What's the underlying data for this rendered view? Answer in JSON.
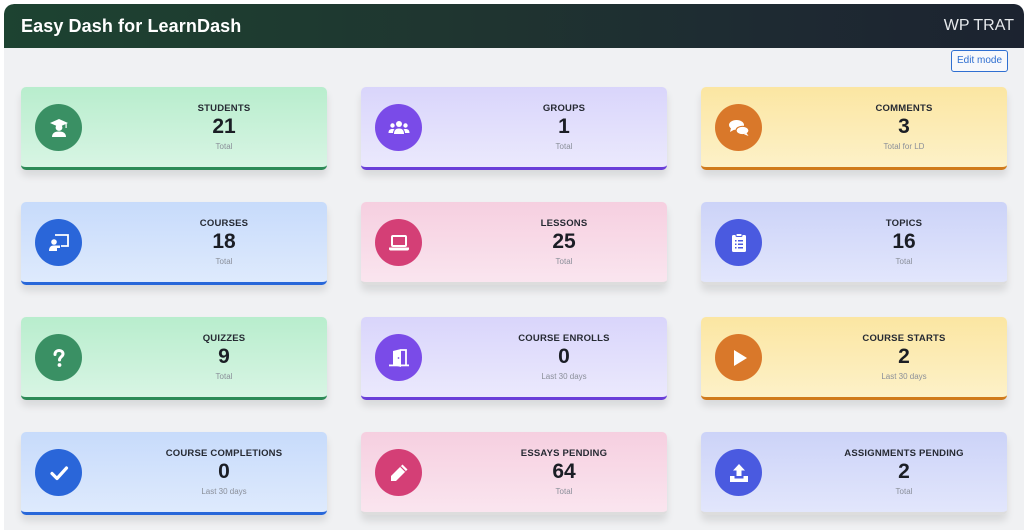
{
  "header": {
    "app_title": "Easy Dash for LearnDash",
    "site_name": "WP TRAT"
  },
  "toolbar": {
    "edit_mode_label": "Edit mode"
  },
  "colors": {
    "green_icon": "#3a9064",
    "purple_icon": "#7a4be8",
    "orange_icon": "#d9782a",
    "blue_icon": "#2a66d9",
    "pink_icon": "#d43f76",
    "indigo_icon": "#4a5ae0"
  },
  "cards": [
    {
      "label": "STUDENTS",
      "value": "21",
      "sub": "Total",
      "icon": "student-icon"
    },
    {
      "label": "GROUPS",
      "value": "1",
      "sub": "Total",
      "icon": "users-icon"
    },
    {
      "label": "COMMENTS",
      "value": "3",
      "sub": "Total for LD",
      "icon": "comments-icon"
    },
    {
      "label": "COURSES",
      "value": "18",
      "sub": "Total",
      "icon": "chalkboard-teacher-icon"
    },
    {
      "label": "LESSONS",
      "value": "25",
      "sub": "Total",
      "icon": "laptop-icon"
    },
    {
      "label": "TOPICS",
      "value": "16",
      "sub": "Total",
      "icon": "clipboard-list-icon"
    },
    {
      "label": "QUIZZES",
      "value": "9",
      "sub": "Total",
      "icon": "question-icon"
    },
    {
      "label": "COURSE ENROLLS",
      "value": "0",
      "sub": "Last 30 days",
      "icon": "door-open-icon"
    },
    {
      "label": "COURSE STARTS",
      "value": "2",
      "sub": "Last 30 days",
      "icon": "play-icon"
    },
    {
      "label": "COURSE COMPLETIONS",
      "value": "0",
      "sub": "Last 30 days",
      "icon": "check-icon"
    },
    {
      "label": "ESSAYS PENDING",
      "value": "64",
      "sub": "Total",
      "icon": "pencil-icon"
    },
    {
      "label": "ASSIGNMENTS PENDING",
      "value": "2",
      "sub": "Total",
      "icon": "upload-icon"
    }
  ]
}
